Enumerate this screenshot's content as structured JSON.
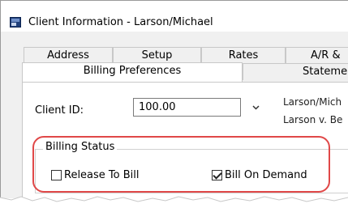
{
  "window": {
    "title": "Client Information - Larson/Michael",
    "app_icon": "client-info-app-icon"
  },
  "tabs": {
    "row1": [
      {
        "label": "Address"
      },
      {
        "label": "Setup"
      },
      {
        "label": "Rates"
      },
      {
        "label": "A/R &"
      }
    ],
    "row2": [
      {
        "label": "Billing Preferences",
        "active": true
      },
      {
        "label": "Statemer"
      }
    ]
  },
  "client": {
    "id_label": "Client ID:",
    "id_value": "100.00",
    "dropdown_icon": "chevron-down-icon",
    "name_line1": "Larson/Mich",
    "name_line2": "Larson v. Be"
  },
  "billing_status": {
    "title": "Billing Status",
    "release_to_bill": {
      "label": "Release To Bill",
      "checked": false
    },
    "bill_on_demand": {
      "label": "Bill On Demand",
      "checked": true
    }
  },
  "colors": {
    "highlight": "#e04848",
    "window_bg": "#f0f0f0",
    "panel_bg": "#ffffff"
  }
}
